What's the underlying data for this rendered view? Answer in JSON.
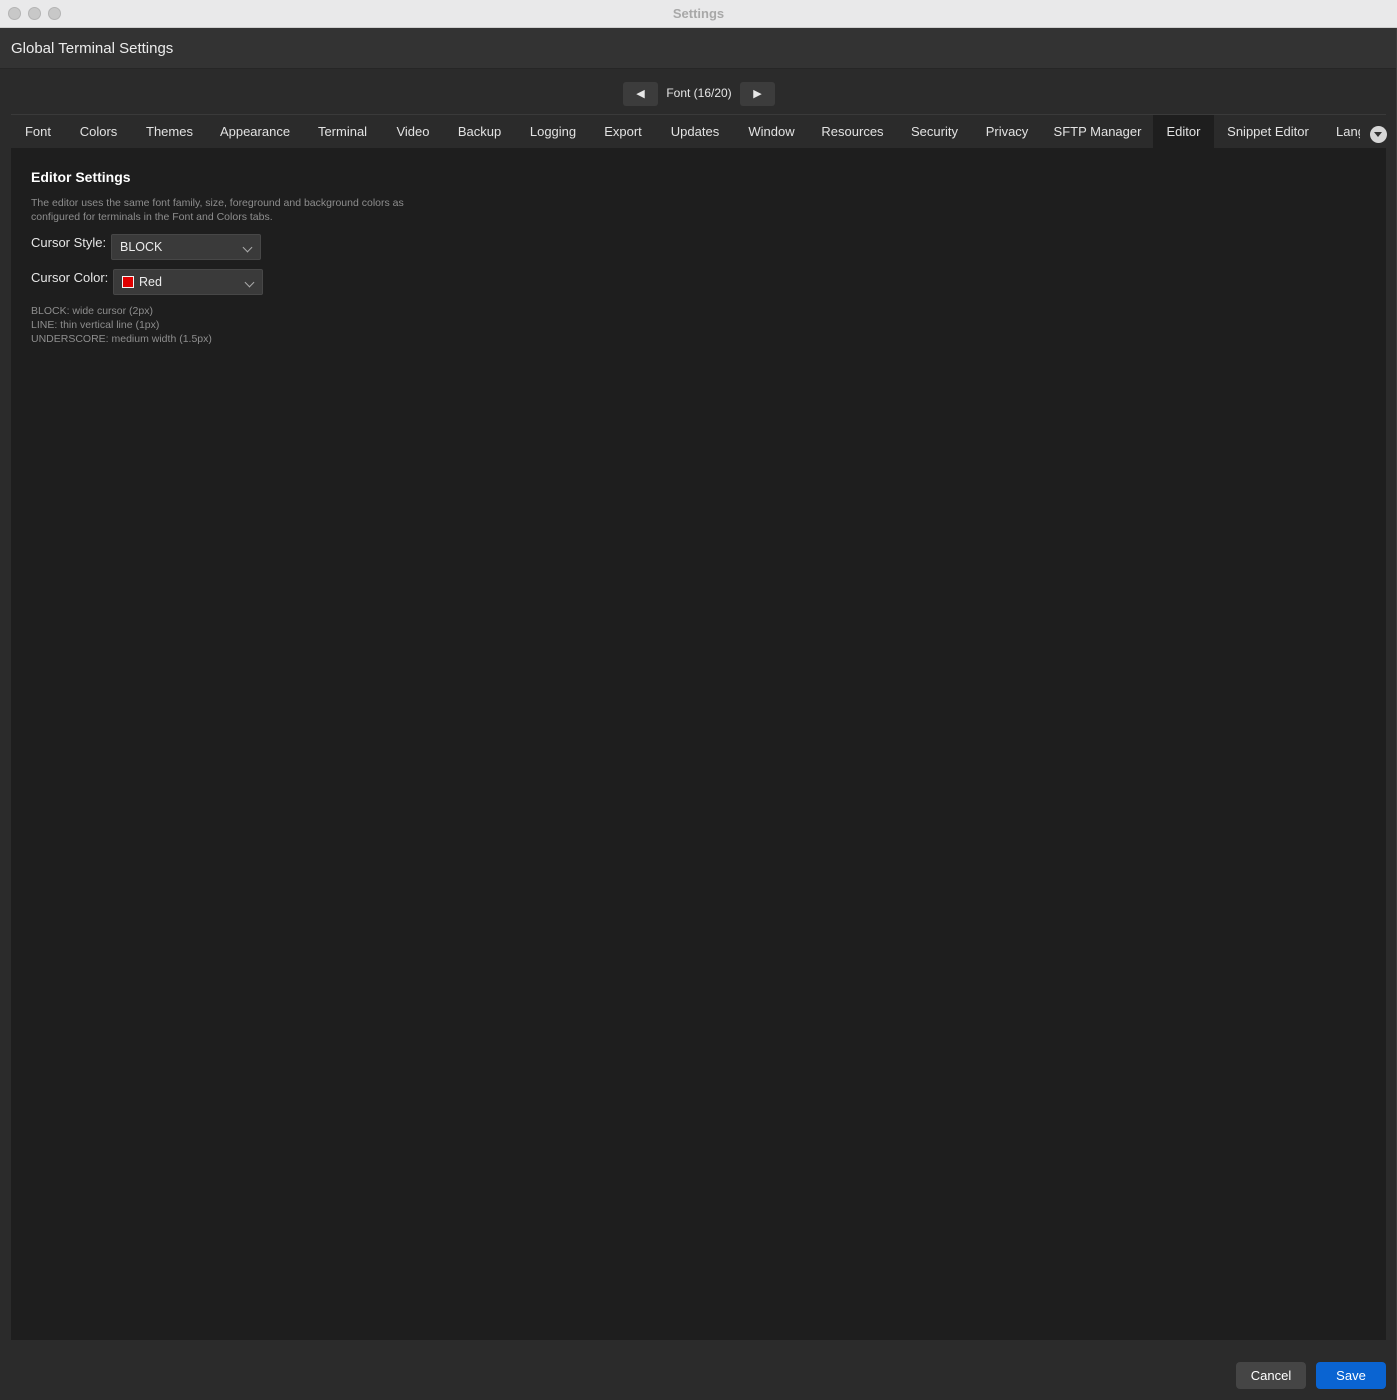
{
  "window": {
    "title": "Settings"
  },
  "header": {
    "title": "Global Terminal Settings"
  },
  "nav": {
    "prev_glyph": "◀",
    "label": "Font (16/20)",
    "next_glyph": "▶"
  },
  "tabs": [
    {
      "label": "Font"
    },
    {
      "label": "Colors"
    },
    {
      "label": "Themes"
    },
    {
      "label": "Appearance"
    },
    {
      "label": "Terminal"
    },
    {
      "label": "Video"
    },
    {
      "label": "Backup"
    },
    {
      "label": "Logging"
    },
    {
      "label": "Export"
    },
    {
      "label": "Updates"
    },
    {
      "label": "Window"
    },
    {
      "label": "Resources"
    },
    {
      "label": "Security"
    },
    {
      "label": "Privacy"
    },
    {
      "label": "SFTP Manager"
    },
    {
      "label": "Editor",
      "active": true
    },
    {
      "label": "Snippet Editor"
    },
    {
      "label": "Lang"
    }
  ],
  "editor": {
    "title": "Editor Settings",
    "description": "The editor uses the same font family, size, foreground and background colors as configured for terminals in the Font and Colors tabs.",
    "cursor_style_label": "Cursor Style:",
    "cursor_style_value": "BLOCK",
    "cursor_color_label": "Cursor Color:",
    "cursor_color_value": "Red",
    "cursor_color_swatch": "#e00000",
    "hints": [
      "BLOCK: wide cursor (2px)",
      "LINE: thin vertical line (1px)",
      "UNDERSCORE: medium width (1.5px)"
    ]
  },
  "footer": {
    "cancel_label": "Cancel",
    "save_label": "Save"
  },
  "icons": {
    "tab_overflow": "chevron-down-circle-icon"
  }
}
